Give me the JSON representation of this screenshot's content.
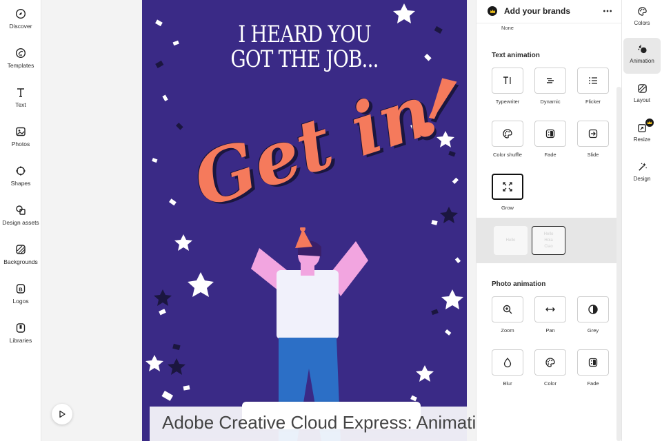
{
  "left_rail": {
    "items": [
      {
        "label": "Discover",
        "icon": "compass-icon"
      },
      {
        "label": "Templates",
        "icon": "templates-icon"
      },
      {
        "label": "Text",
        "icon": "text-icon"
      },
      {
        "label": "Photos",
        "icon": "photo-icon"
      },
      {
        "label": "Shapes",
        "icon": "shapes-icon"
      },
      {
        "label": "Design assets",
        "icon": "design-assets-icon"
      },
      {
        "label": "Backgrounds",
        "icon": "backgrounds-icon"
      },
      {
        "label": "Logos",
        "icon": "logo-icon"
      },
      {
        "label": "Libraries",
        "icon": "libraries-icon"
      }
    ]
  },
  "canvas": {
    "headline_line1": "I HEARD YOU",
    "headline_line2": "GOT THE JOB...",
    "main_text": "Get in",
    "exclamation": "!",
    "colors": {
      "background": "#3a2a86",
      "accent": "#f57a5c",
      "text": "#ffffff"
    }
  },
  "play_button_icon": "play-icon",
  "caption": "Adobe Creative Cloud Express: Animation",
  "panel": {
    "header_title": "Add your brands",
    "top_option_label": "None",
    "text_animation": {
      "title": "Text animation",
      "options": [
        {
          "label": "Typewriter",
          "icon": "typewriter-icon"
        },
        {
          "label": "Dynamic",
          "icon": "dynamic-icon"
        },
        {
          "label": "Flicker",
          "icon": "flicker-icon"
        },
        {
          "label": "Color shuffle",
          "icon": "palette-icon"
        },
        {
          "label": "Fade",
          "icon": "fade-icon"
        },
        {
          "label": "Slide",
          "icon": "slide-icon"
        },
        {
          "label": "Grow",
          "icon": "grow-icon",
          "selected": true
        }
      ],
      "style_previews": [
        {
          "text": "Hello"
        },
        {
          "line1": "Hello",
          "line2": "Hola",
          "line3": "Ciao",
          "selected": true
        }
      ]
    },
    "photo_animation": {
      "title": "Photo animation",
      "options": [
        {
          "label": "Zoom",
          "icon": "zoom-icon"
        },
        {
          "label": "Pan",
          "icon": "pan-icon"
        },
        {
          "label": "Grey",
          "icon": "contrast-icon"
        },
        {
          "label": "Blur",
          "icon": "blur-drop-icon"
        },
        {
          "label": "Color",
          "icon": "palette-icon"
        },
        {
          "label": "Fade",
          "icon": "fade-icon"
        }
      ]
    }
  },
  "right_rail": {
    "items": [
      {
        "label": "Colors",
        "icon": "palette-icon"
      },
      {
        "label": "Animation",
        "icon": "animation-icon",
        "active": true
      },
      {
        "label": "Layout",
        "icon": "layout-icon"
      },
      {
        "label": "Resize",
        "icon": "resize-icon",
        "premium": true
      },
      {
        "label": "Design",
        "icon": "magic-wand-icon"
      }
    ]
  }
}
